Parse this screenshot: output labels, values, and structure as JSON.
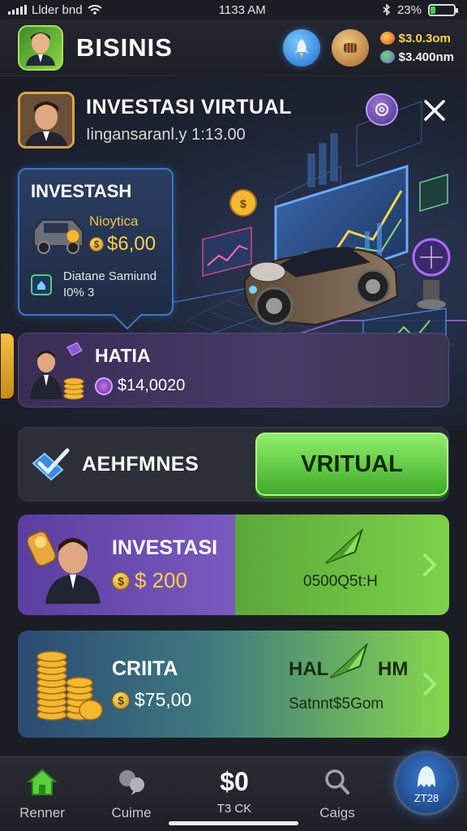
{
  "status_bar": {
    "carrier": "Llder bnd",
    "time": "1133 AM",
    "battery": "23%",
    "battery_level": 0.23
  },
  "header": {
    "title": "BISINIS",
    "balance_primary": "$3.0.3om",
    "balance_secondary": "$3.400nm",
    "icons": [
      "rocket-icon",
      "fist-icon"
    ]
  },
  "hero": {
    "title": "INVESTASI VIRTUAL",
    "subtitle": "Iingansaranl.y 1:13.00",
    "icons": [
      "badge-icon",
      "close-icon"
    ]
  },
  "invest_card": {
    "title": "INVESTASH",
    "item_label": "Nioytica",
    "price": "$6,00",
    "footer_line1": "Diatane Samiund",
    "footer_line2": "I0%  3"
  },
  "hatia": {
    "title": "HATIA",
    "value": "$14,0020"
  },
  "toggle": {
    "label": "AEHFMNES",
    "button_label": "VRITUAL"
  },
  "offers": [
    {
      "title": "INVESTASI",
      "price": "$ 200",
      "code": "0500Q5t:H"
    },
    {
      "title": "CRIITA",
      "price": "$75,00",
      "right_left": "HAL",
      "right_right": "HM",
      "code": "Satnnt$5Gom"
    }
  ],
  "bottom_nav": {
    "home_label": "Renner",
    "chat_label": "Cuime",
    "center_value": "$0",
    "center_label": "T3 CK",
    "search_label": "Caigs",
    "fab_label": "ZT28"
  },
  "colors": {
    "accent_green": "#7dd24a",
    "accent_purple": "#5a3ea0",
    "accent_gold": "#ffcf4a",
    "background": "#1b1d24"
  }
}
